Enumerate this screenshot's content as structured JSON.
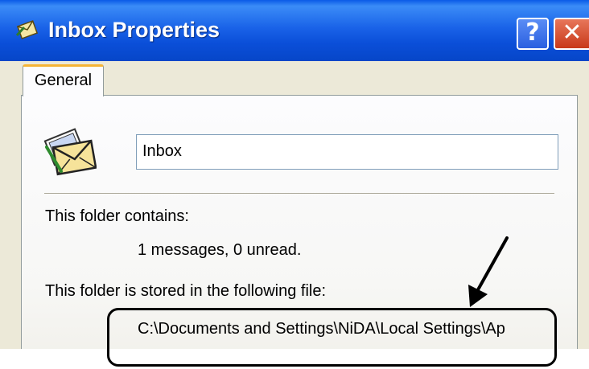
{
  "window": {
    "title": "Inbox Properties",
    "help_glyph": "?",
    "close_glyph": "✕"
  },
  "tabs": [
    {
      "label": "General",
      "selected": true
    }
  ],
  "general": {
    "folder_name": "Inbox",
    "contains_label": "This folder contains:",
    "contains_value": "1 messages, 0 unread.",
    "stored_label": "This folder is stored in the following file:",
    "stored_path": "C:\\Documents and Settings\\NiDA\\Local Settings\\Ap"
  },
  "icons": {
    "title": "outlook-express-folder-icon",
    "folder": "mail-folder-envelope-icon",
    "help": "help-icon",
    "close": "close-icon",
    "annotation_arrow": "arrow-icon"
  },
  "colors": {
    "titlebar": "#0b4fd9",
    "tab_highlight": "#f5b436",
    "close_button": "#c8391a",
    "annotation": "#000000"
  }
}
